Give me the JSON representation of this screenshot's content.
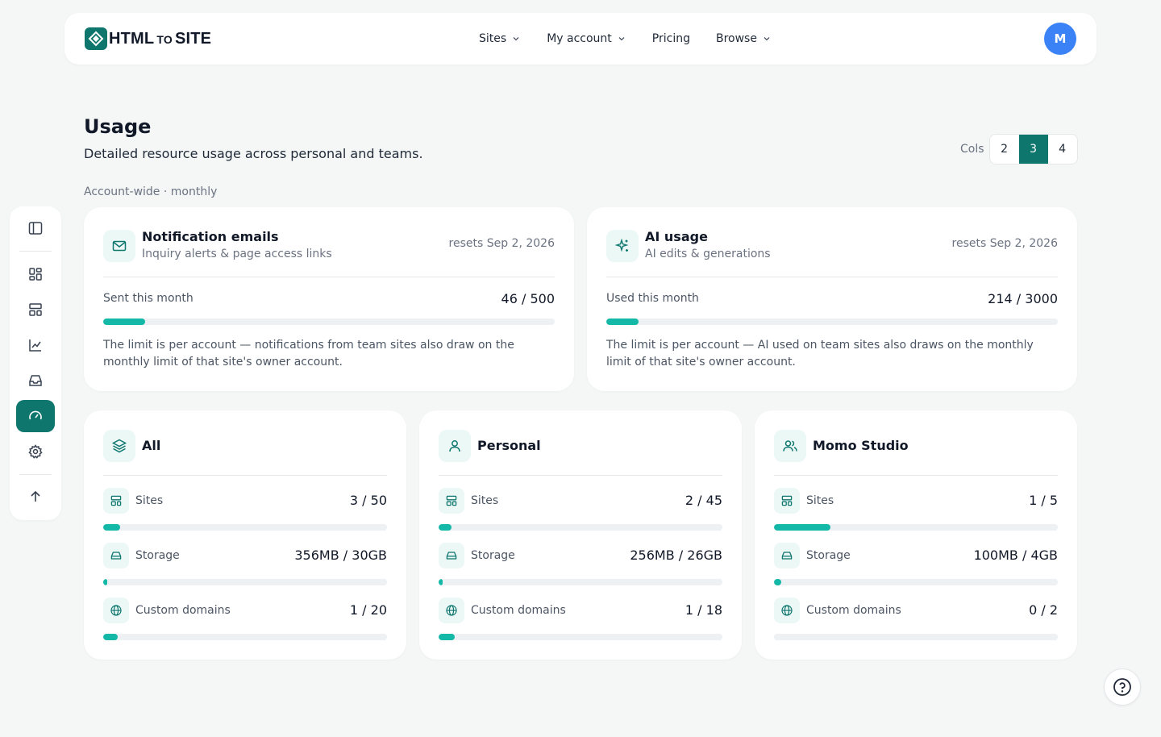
{
  "brand": {
    "name_main": "HTML",
    "name_small": "TO",
    "name_end": "SITE",
    "logo_icon": "diamond-logo-icon",
    "accent": "#0f766e"
  },
  "nav": {
    "items": [
      {
        "label": "Sites",
        "has_dropdown": true
      },
      {
        "label": "My account",
        "has_dropdown": true
      },
      {
        "label": "Pricing",
        "has_dropdown": false
      },
      {
        "label": "Browse",
        "has_dropdown": true
      }
    ]
  },
  "user": {
    "initial": "M",
    "avatar_color": "#3b82f6"
  },
  "rail": {
    "items": [
      "sidebar-toggle-icon",
      "dashboard-icon",
      "sites-icon",
      "analytics-icon",
      "inbox-icon",
      "usage-gauge-icon",
      "settings-gear-icon",
      "scroll-top-icon"
    ],
    "active": "usage-gauge-icon"
  },
  "header": {
    "title": "Usage",
    "subtitle": "Detailed resource usage across personal and teams."
  },
  "cols": {
    "label": "Cols",
    "options": [
      "2",
      "3",
      "4"
    ],
    "selected": "3"
  },
  "section": {
    "label": "Account-wide · monthly"
  },
  "account_cards": [
    {
      "title": "Notification emails",
      "subtitle": "Inquiry alerts & page access links",
      "reset": "resets Sep 2, 2026",
      "metric_label": "Sent this month",
      "value_text": "46 / 500",
      "fraction": 0.092,
      "note": "The limit is per account — notifications from team sites also draw on the monthly limit of that site's owner account.",
      "icon": "mail-icon"
    },
    {
      "title": "AI usage",
      "subtitle": "AI edits & generations",
      "reset": "resets Sep 2, 2026",
      "metric_label": "Used this month",
      "value_text": "214 / 3000",
      "fraction": 0.0713,
      "note": "The limit is per account — AI used on team sites also draws on the monthly limit of that site's owner account.",
      "icon": "sparkles-icon"
    }
  ],
  "scope_cards": [
    {
      "title": "All",
      "icon": "layers-icon",
      "metrics": [
        {
          "label": "Sites",
          "value_text": "3 / 50",
          "fraction": 0.06,
          "icon": "sites-icon"
        },
        {
          "label": "Storage",
          "value_text": "356MB / 30GB",
          "fraction": 0.0116,
          "icon": "storage-drive-icon"
        },
        {
          "label": "Custom domains",
          "value_text": "1 / 20",
          "fraction": 0.05,
          "icon": "globe-icon"
        }
      ]
    },
    {
      "title": "Personal",
      "icon": "user-icon",
      "metrics": [
        {
          "label": "Sites",
          "value_text": "2 / 45",
          "fraction": 0.0444,
          "icon": "sites-icon"
        },
        {
          "label": "Storage",
          "value_text": "256MB / 26GB",
          "fraction": 0.0096,
          "icon": "storage-drive-icon"
        },
        {
          "label": "Custom domains",
          "value_text": "1 / 18",
          "fraction": 0.0556,
          "icon": "globe-icon"
        }
      ]
    },
    {
      "title": "Momo Studio",
      "icon": "team-users-icon",
      "metrics": [
        {
          "label": "Sites",
          "value_text": "1 / 5",
          "fraction": 0.2,
          "icon": "sites-icon"
        },
        {
          "label": "Storage",
          "value_text": "100MB / 4GB",
          "fraction": 0.0244,
          "icon": "storage-drive-icon"
        },
        {
          "label": "Custom domains",
          "value_text": "0 / 2",
          "fraction": 0.0,
          "icon": "globe-icon"
        }
      ]
    }
  ],
  "help": {
    "icon": "help-circle-icon"
  }
}
